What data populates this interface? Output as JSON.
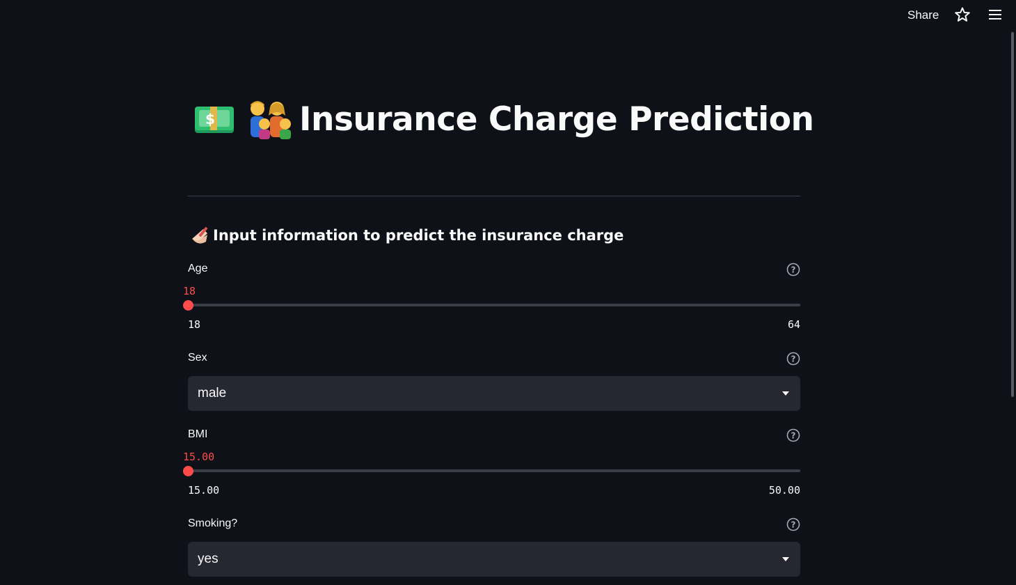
{
  "toolbar": {
    "share_label": "Share",
    "star_icon": "star-icon",
    "menu_icon": "hamburger-menu-icon"
  },
  "header": {
    "title": "Insurance Charge Prediction",
    "title_emojis": [
      "dollar-banknote-emoji",
      "family-emoji"
    ]
  },
  "form": {
    "subheader": "Input information to predict the insurance charge",
    "subheader_emoji": "writing-hand-emoji",
    "age": {
      "label": "Age",
      "value": "18",
      "min": "18",
      "max": "64",
      "fraction": 0
    },
    "sex": {
      "label": "Sex",
      "selected": "male"
    },
    "bmi": {
      "label": "BMI",
      "value": "15.00",
      "min": "15.00",
      "max": "50.00",
      "fraction": 0
    },
    "smoking": {
      "label": "Smoking?",
      "selected": "yes"
    }
  },
  "colors": {
    "background": "#0e1117",
    "accent": "#ff4b4b",
    "select_background": "#262730",
    "text": "#fafafa"
  }
}
